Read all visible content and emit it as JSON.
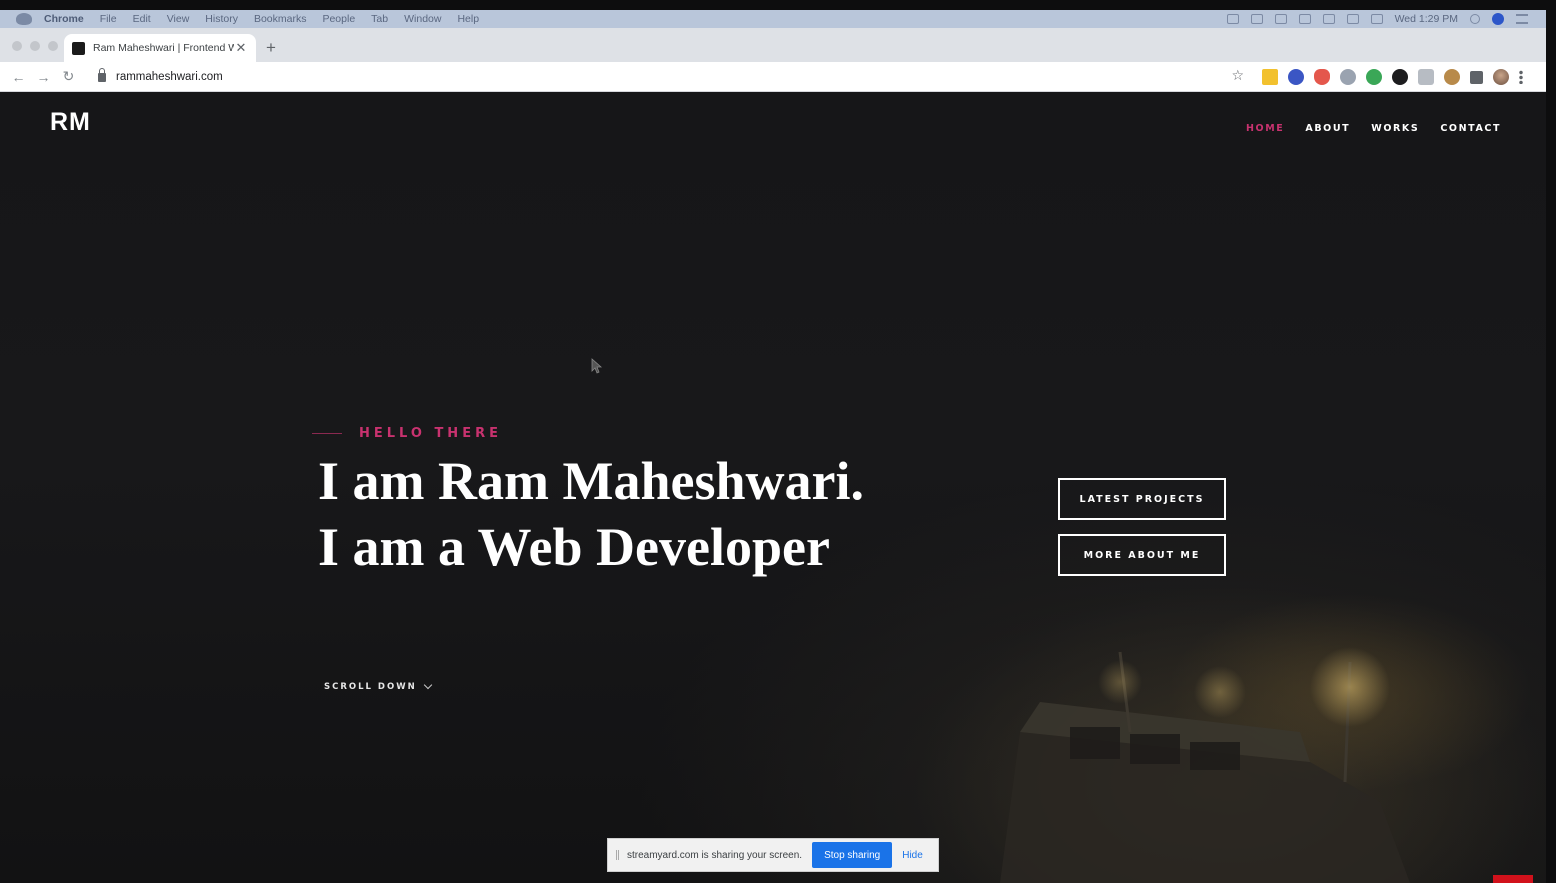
{
  "menubar": {
    "app": "Chrome",
    "items": [
      "File",
      "Edit",
      "View",
      "History",
      "Bookmarks",
      "People",
      "Tab",
      "Window",
      "Help"
    ],
    "clock": "Wed 1:29 PM"
  },
  "browser": {
    "tab_title": "Ram Maheshwari | Frontend W",
    "url": "rammaheshwari.com",
    "extension_icons": [
      "notes-icon",
      "cloud-badge-icon",
      "shield-icon",
      "sync-icon",
      "green-circle-icon",
      "dark-circle-icon",
      "camera-icon",
      "face-icon",
      "puzzle-icon",
      "profile-avatar"
    ]
  },
  "site": {
    "brand": "RM",
    "nav": [
      {
        "label": "HOME",
        "active": true
      },
      {
        "label": "ABOUT",
        "active": false
      },
      {
        "label": "WORKS",
        "active": false
      },
      {
        "label": "CONTACT",
        "active": false
      }
    ],
    "hello": "HELLO THERE",
    "headline_1": "I am Ram Maheshwari.",
    "headline_2": "I am a Web Developer",
    "buttons": {
      "latest": "LATEST PROJECTS",
      "more": "MORE ABOUT ME"
    },
    "scroll": "SCROLL DOWN"
  },
  "share_bar": {
    "message": "streamyard.com is sharing your screen.",
    "stop": "Stop sharing",
    "hide": "Hide"
  },
  "colors": {
    "accent": "#c8326f",
    "background": "#161618",
    "chrome_blue": "#1a73e8"
  }
}
